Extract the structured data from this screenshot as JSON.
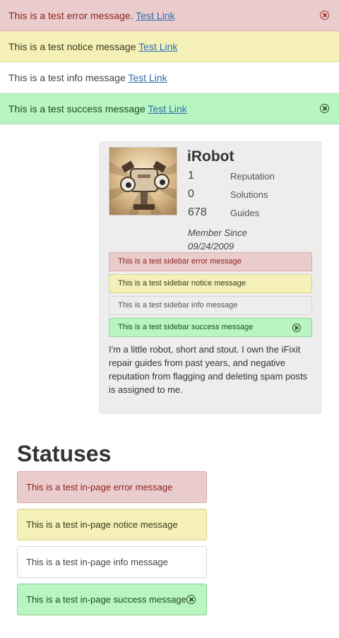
{
  "banners": {
    "error": {
      "text": "This is a test error message.",
      "link": "Test Link"
    },
    "notice": {
      "text": "This is a test notice message",
      "link": "Test Link"
    },
    "info": {
      "text": "This is a test info message",
      "link": "Test Link"
    },
    "success": {
      "text": "This is a test success message",
      "link": "Test Link"
    }
  },
  "profile": {
    "username": "iRobot",
    "stats": [
      {
        "value": "1",
        "label": "Reputation"
      },
      {
        "value": "0",
        "label": "Solutions"
      },
      {
        "value": "678",
        "label": "Guides"
      }
    ],
    "member_since_label": "Member Since",
    "member_since_date": "09/24/2009",
    "bio": "I'm a little robot, short and stout. I own the iFixit repair guides from past years, and negative reputation from flagging and deleting spam posts is assigned to me."
  },
  "sidebar_messages": {
    "error": "This is a test sidebar error message",
    "notice": "This is a test sidebar notice message",
    "info": "This is a test sidebar info message",
    "success": "This is a test sidebar success message"
  },
  "statuses": {
    "heading": "Statuses",
    "error": "This is a test in-page error message",
    "notice": "This is a test in-page notice message",
    "info": "This is a test in-page info message",
    "success": "This is a test in-page success message"
  },
  "colors": {
    "error_bg": "#ebcccc",
    "notice_bg": "#f5f0b8",
    "success_bg": "#b8f5c0",
    "sidebar_bg": "#ededed",
    "link": "#2a6fb0"
  }
}
